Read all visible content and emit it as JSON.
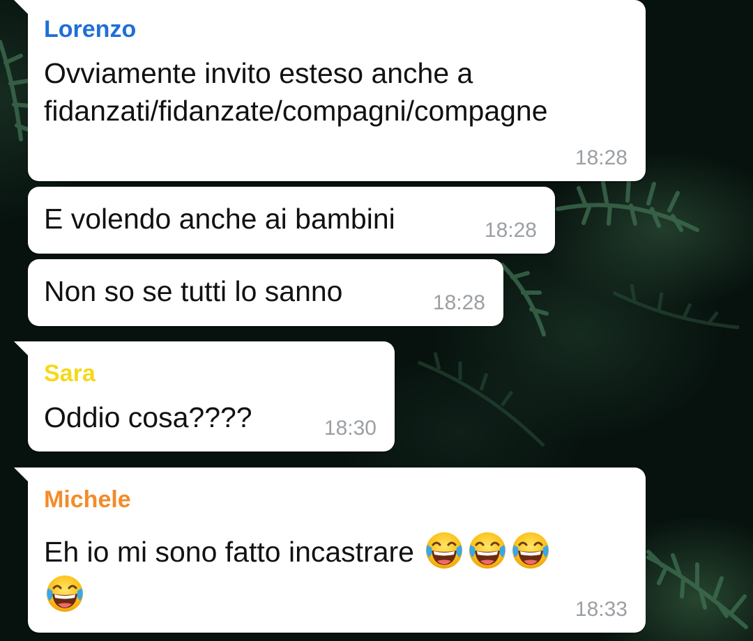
{
  "messages": [
    {
      "sender": "Lorenzo",
      "sender_color": "#1f6fd6",
      "text_lines": [
        "Ovviamente invito esteso anche a",
        "fidanzati/fidanzate/compagni/compagne"
      ],
      "time": "18:28"
    },
    {
      "text": "E volendo anche ai bambini",
      "time": "18:28"
    },
    {
      "text": "Non so se tutti lo sanno",
      "time": "18:28"
    },
    {
      "sender": "Sara",
      "sender_color": "#f4d91a",
      "text": "Oddio cosa????",
      "time": "18:30"
    },
    {
      "sender": "Michele",
      "sender_color": "#f28c2a",
      "text": "Eh io mi sono fatto incastrare",
      "emojis": [
        "face-with-tears-of-joy",
        "face-with-tears-of-joy",
        "face-with-tears-of-joy",
        "face-with-tears-of-joy"
      ],
      "time": "18:33"
    }
  ],
  "colors": {
    "bubble": "#ffffff",
    "timestamp": "#9a9fa4",
    "wallpaper": "#07120e"
  }
}
